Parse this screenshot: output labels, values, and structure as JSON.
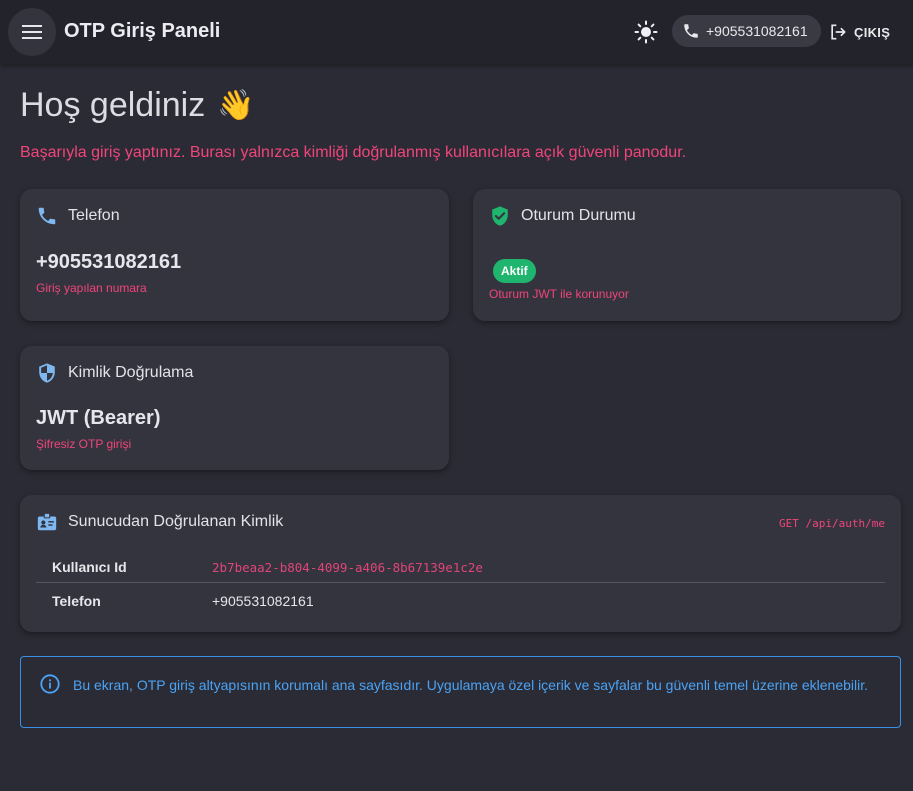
{
  "header": {
    "title": "OTP Giriş Paneli",
    "phone": "+905531082161",
    "logout_label": "ÇIKIŞ"
  },
  "welcome": {
    "title": "Hoş geldiniz",
    "emoji": "👋",
    "subtitle": "Başarıyla giriş yaptınız. Burası yalnızca kimliği doğrulanmış kullanıcılara açık güvenli panodur."
  },
  "cards": {
    "phone": {
      "title": "Telefon",
      "value": "+905531082161",
      "note": "Giriş yapılan numara"
    },
    "session": {
      "title": "Oturum Durumu",
      "badge": "Aktif",
      "note": "Oturum JWT ile korunuyor"
    },
    "auth": {
      "title": "Kimlik Doğrulama",
      "value": "JWT (Bearer)",
      "note": "Şifresiz OTP girişi"
    }
  },
  "identity": {
    "title": "Sunucudan Doğrulanan Kimlik",
    "endpoint": "GET /api/auth/me",
    "rows": [
      {
        "key": "Kullanıcı Id",
        "value": "2b7beaa2-b804-4099-a406-8b67139e1c2e"
      },
      {
        "key": "Telefon",
        "value": "+905531082161"
      }
    ]
  },
  "info": {
    "text": "Bu ekran, OTP giriş altyapısının korumalı ana sayfasıdır. Uygulamaya özel içerik ve sayfalar bu güvenli temel üzerine eklenebilir."
  },
  "colors": {
    "accent_pink": "#f0457a",
    "success_green": "#1fb56f",
    "info_blue": "#4aa3f5",
    "phone_icon": "#7fb8f0",
    "shield_green": "#1fb56f"
  },
  "icons": {
    "menu": "menu-icon",
    "theme": "sun-icon",
    "phone": "phone-icon",
    "logout": "logout-icon",
    "session": "verified-shield-icon",
    "auth": "security-shield-icon",
    "identity": "badge-icon",
    "info": "info-icon"
  }
}
